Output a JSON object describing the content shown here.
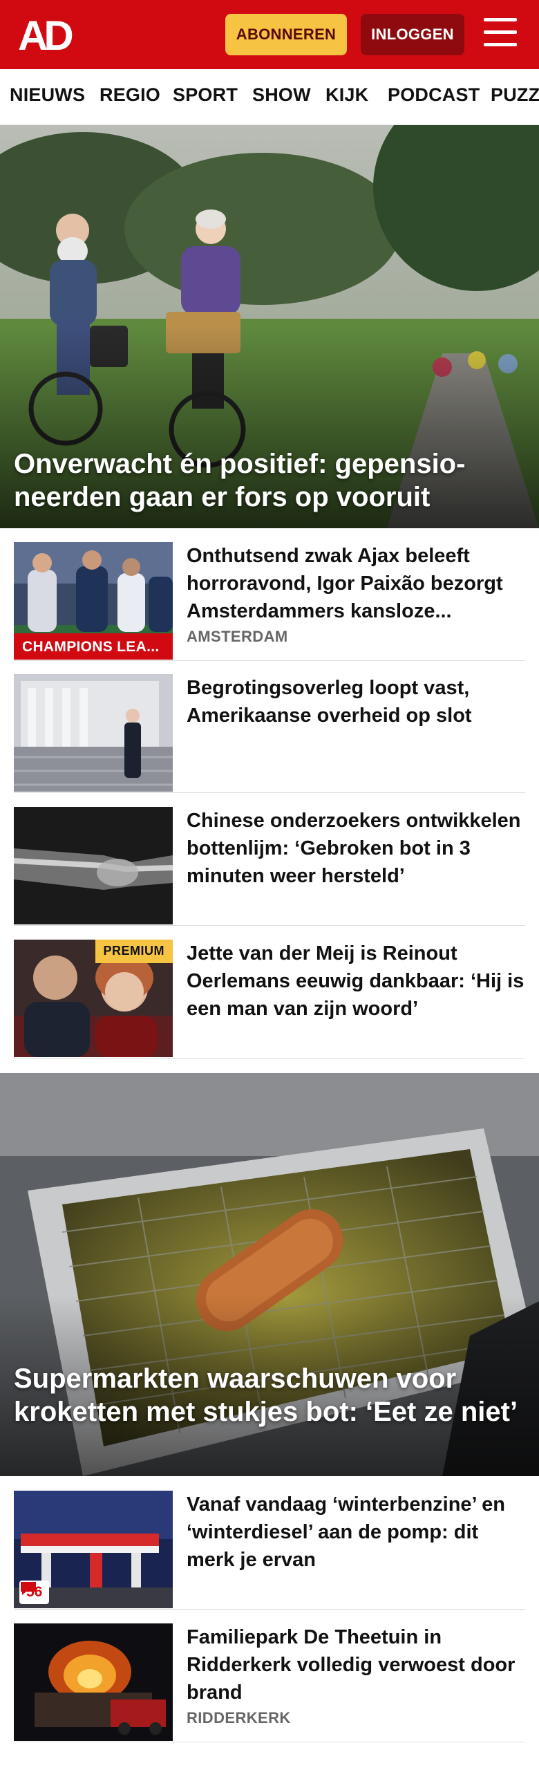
{
  "header": {
    "logo_text": "AD",
    "subscribe_label": "ABONNEREN",
    "login_label": "INLOGGEN",
    "menu_icon": "hamburger-menu-icon",
    "brand_color": "#d10a11",
    "accent_color": "#f6c343"
  },
  "nav": {
    "items": [
      "NIEUWS",
      "REGIO",
      "SPORT",
      "SHOW",
      "KIJK",
      "PODCAST",
      "PUZZ"
    ]
  },
  "articles": [
    {
      "type": "hero",
      "title": "Onverwacht én positief: gepensio­neerden gaan er fors op vooruit"
    },
    {
      "type": "list",
      "title": "Onthutsend zwak Ajax beleeft horroravond, Igor Paixão bezorgt Amsterdammers kansloze...",
      "location": "AMSTERDAM",
      "badge": "CHAMPIONS LEA..."
    },
    {
      "type": "list",
      "title": "Begrotingsoverleg loopt vast, Amerikaanse overheid op slot"
    },
    {
      "type": "list",
      "title": "Chinese onderzoekers ontwikke­len bottenlijm: ‘Gebroken bot in 3 minuten weer hersteld’"
    },
    {
      "type": "list",
      "title": "Jette van der Meij is Reinout Oerlemans eeuwig dankbaar: ‘Hij is een man van zijn woord’",
      "badge": "PREMIUM"
    },
    {
      "type": "hero",
      "title": "Supermarkten waarschuwen voor kroketten met stukjes bot: ‘Eet ze niet’"
    },
    {
      "type": "list",
      "title": "Vanaf vandaag ‘winterbenzine’ en ‘winterdiesel’ aan de pomp: dit merk je ervan",
      "comments": "56",
      "comment_icon": "comment-icon"
    },
    {
      "type": "list",
      "title": "Familiepark De Theetuin in Ridderkerk volledig verwoest door brand",
      "location": "RIDDERKERK"
    }
  ]
}
